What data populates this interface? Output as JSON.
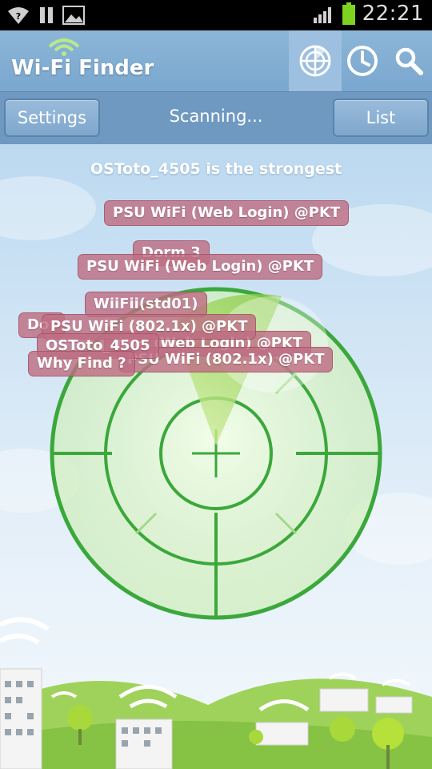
{
  "status_bar": {
    "time": "22:21",
    "icons": [
      "wifi-icon",
      "pause-icon",
      "image-icon",
      "signal-icon",
      "battery-icon"
    ]
  },
  "header": {
    "app_title": "Wi-Fi Finder",
    "tabs": [
      {
        "name": "radar",
        "icon": "radar-icon",
        "active": true
      },
      {
        "name": "history",
        "icon": "clock-icon",
        "active": false
      },
      {
        "name": "search",
        "icon": "search-icon",
        "active": false
      }
    ]
  },
  "toolbar": {
    "settings_label": "Settings",
    "status_text": "Scanning...",
    "list_label": "List"
  },
  "radar": {
    "strongest_text": "OSToto_4505 is the strongest",
    "networks": [
      "PSU WiFi (Web Login) @PKT",
      "Dorm 3",
      "PSU WiFi (Web Login) @PKT",
      "WiiFii(std01)",
      "Do",
      "PSU WiFi (802.1x) @PKT",
      "WiFi (Web Login) @PKT",
      "OSToto_4505",
      "Why Find ?",
      "PSU WiFi (802.1x) @PKT"
    ]
  },
  "colors": {
    "accent_blue": "#7aa7cf",
    "radar_green": "#3aa83a",
    "tag_pink": "#be6e82"
  }
}
